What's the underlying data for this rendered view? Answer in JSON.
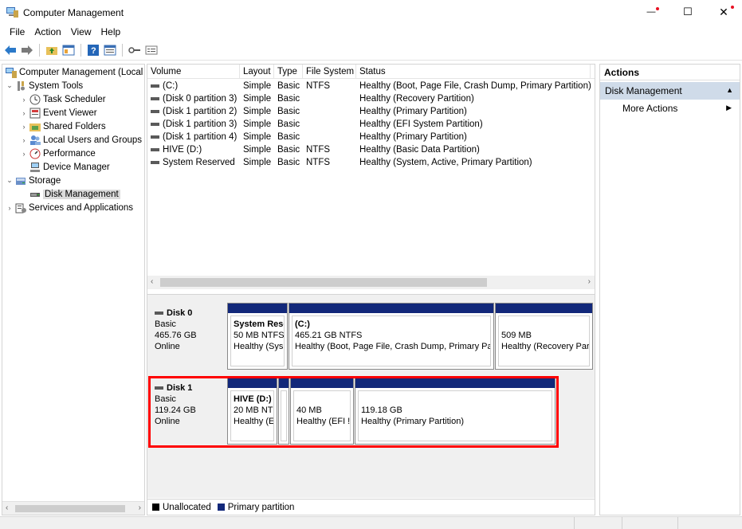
{
  "window": {
    "title": "Computer Management",
    "minimize": "—",
    "maximize": "☐",
    "close": "✕"
  },
  "menu": [
    "File",
    "Action",
    "View",
    "Help"
  ],
  "tree": {
    "items": [
      {
        "label": "Computer Management (Local",
        "level": 0,
        "chev": ""
      },
      {
        "label": "System Tools",
        "level": 1,
        "chev": "⌄"
      },
      {
        "label": "Task Scheduler",
        "level": 2,
        "chev": "›"
      },
      {
        "label": "Event Viewer",
        "level": 2,
        "chev": "›"
      },
      {
        "label": "Shared Folders",
        "level": 2,
        "chev": "›"
      },
      {
        "label": "Local Users and Groups",
        "level": 2,
        "chev": "›"
      },
      {
        "label": "Performance",
        "level": 2,
        "chev": "›"
      },
      {
        "label": "Device Manager",
        "level": 2,
        "chev": ""
      },
      {
        "label": "Storage",
        "level": 1,
        "chev": "⌄"
      },
      {
        "label": "Disk Management",
        "level": 2,
        "chev": "",
        "selected": true
      },
      {
        "label": "Services and Applications",
        "level": 1,
        "chev": "›"
      }
    ]
  },
  "volumes": {
    "headers": [
      "Volume",
      "Layout",
      "Type",
      "File System",
      "Status"
    ],
    "rows": [
      [
        "(C:)",
        "Simple",
        "Basic",
        "NTFS",
        "Healthy (Boot, Page File, Crash Dump, Primary Partition)"
      ],
      [
        "(Disk 0 partition 3)",
        "Simple",
        "Basic",
        "",
        "Healthy (Recovery Partition)"
      ],
      [
        "(Disk 1 partition 2)",
        "Simple",
        "Basic",
        "",
        "Healthy (Primary Partition)"
      ],
      [
        "(Disk 1 partition 3)",
        "Simple",
        "Basic",
        "",
        "Healthy (EFI System Partition)"
      ],
      [
        "(Disk 1 partition 4)",
        "Simple",
        "Basic",
        "",
        "Healthy (Primary Partition)"
      ],
      [
        "HIVE (D:)",
        "Simple",
        "Basic",
        "NTFS",
        "Healthy (Basic Data Partition)"
      ],
      [
        "System Reserved",
        "Simple",
        "Basic",
        "NTFS",
        "Healthy (System, Active, Primary Partition)"
      ]
    ]
  },
  "disks": [
    {
      "name": "Disk 0",
      "type": "Basic",
      "size": "465.76 GB",
      "state": "Online",
      "partitions": [
        {
          "name": "System Rese",
          "size": "50 MB NTFS",
          "status": "Healthy (Sys"
        },
        {
          "name": "(C:)",
          "size": "465.21 GB NTFS",
          "status": "Healthy (Boot, Page File, Crash Dump, Primary Pa"
        },
        {
          "name": "",
          "size": "509 MB",
          "status": "Healthy (Recovery Par"
        }
      ]
    },
    {
      "name": "Disk 1",
      "type": "Basic",
      "size": "119.24 GB",
      "state": "Online",
      "partitions": [
        {
          "name": "HIVE  (D:)",
          "size": "20 MB NTI",
          "status": "Healthy (E"
        },
        {
          "name": "",
          "size": "",
          "status": ""
        },
        {
          "name": "",
          "size": "40 MB",
          "status": "Healthy (EFI !"
        },
        {
          "name": "",
          "size": "119.18 GB",
          "status": "Healthy (Primary Partition)"
        }
      ]
    }
  ],
  "legend": {
    "unallocated": "Unallocated",
    "primary": "Primary partition",
    "unallocated_color": "#000000",
    "primary_color": "#12287a"
  },
  "actions": {
    "header": "Actions",
    "section": "Disk Management",
    "more": "More Actions"
  },
  "colors": {
    "partition_bar": "#12287a",
    "selection_highlight": "#ff0000",
    "actions_section_bg": "#cfdbe9"
  }
}
